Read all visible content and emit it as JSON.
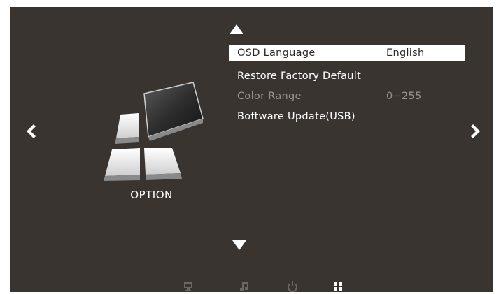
{
  "category": {
    "title": "OPTION",
    "icon": "option-tiles-icon"
  },
  "navigation": {
    "up_icon": "triangle-up-icon",
    "down_icon": "triangle-down-icon",
    "left_icon": "chevron-left-icon",
    "right_icon": "chevron-right-icon"
  },
  "menu": [
    {
      "label": "OSD Language",
      "value": "English",
      "state": "selected"
    },
    {
      "label": "Restore Factory Default",
      "value": "",
      "state": "normal"
    },
    {
      "label": "Color Range",
      "value": "0−255",
      "state": "disabled"
    },
    {
      "label": "Boftware Update(USB)",
      "value": "",
      "state": "normal"
    }
  ],
  "bottom_tabs": [
    {
      "icon": "monitor-icon"
    },
    {
      "icon": "music-note-icon"
    },
    {
      "icon": "power-icon"
    },
    {
      "icon": "grid-icon",
      "active": true
    }
  ],
  "colors": {
    "panel_bg": "#3a3431",
    "text": "#ffffff",
    "disabled_text": "#9a9490",
    "selection_bg": "#ffffff",
    "selection_text": "#2a2624"
  }
}
